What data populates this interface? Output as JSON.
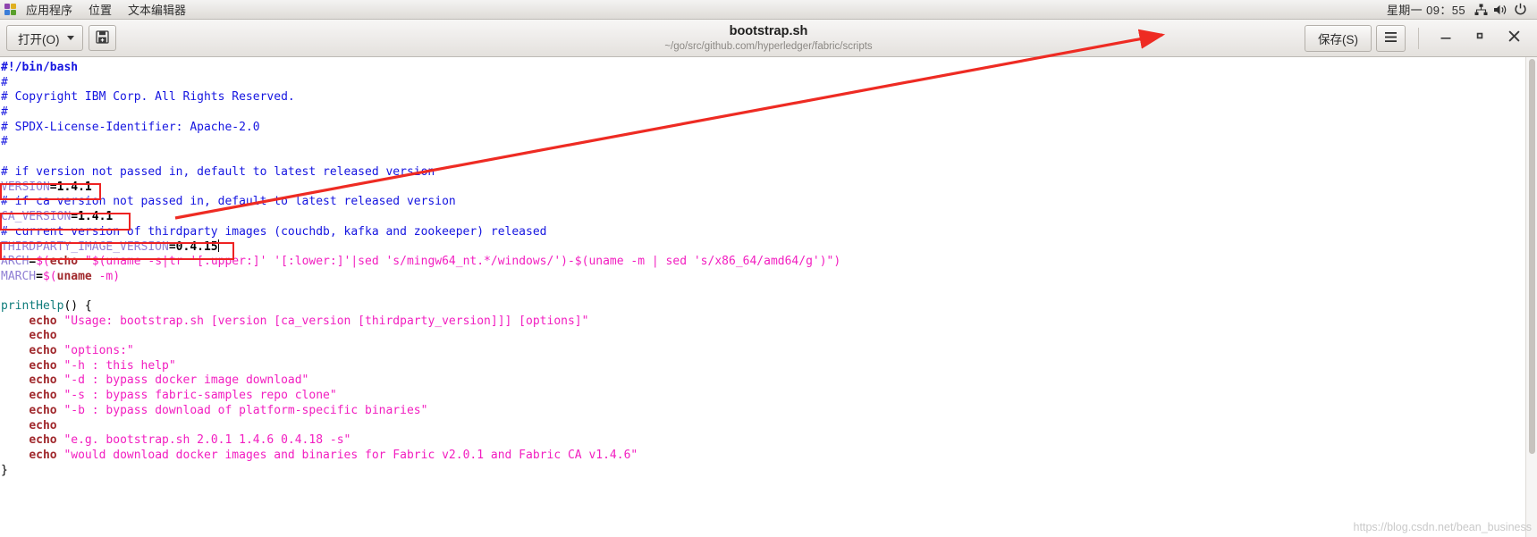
{
  "panel": {
    "apps_icon": "applications-icon",
    "items": [
      {
        "label": "应用程序",
        "name": "panel-menu-applications"
      },
      {
        "label": "位置",
        "name": "panel-menu-places"
      },
      {
        "label": "文本编辑器",
        "name": "panel-menu-text-editor"
      }
    ],
    "clock": "星期一 09：55",
    "tray": [
      {
        "name": "network-icon"
      },
      {
        "name": "volume-icon"
      },
      {
        "name": "power-icon"
      }
    ]
  },
  "headerbar": {
    "open_label": "打开(O)",
    "save_sidebar_icon": "save-document-icon",
    "title": "bootstrap.sh",
    "subtitle": "~/go/src/github.com/hyperledger/fabric/scripts",
    "save_label": "保存(S)",
    "menu_icon": "hamburger-menu-icon",
    "minimize_icon": "minimize-icon",
    "maximize_icon": "maximize-icon",
    "close_icon": "close-icon"
  },
  "editor": {
    "filename": "bootstrap.sh",
    "lines": [
      "#!/bin/bash",
      "#",
      "# Copyright IBM Corp. All Rights Reserved.",
      "#",
      "# SPDX-License-Identifier: Apache-2.0",
      "#",
      "",
      "# if version not passed in, default to latest released version",
      "VERSION=1.4.1",
      "# if ca version not passed in, default to latest released version",
      "CA_VERSION=1.4.1",
      "# current version of thirdparty images (couchdb, kafka and zookeeper) released",
      "THIRDPARTY_IMAGE_VERSION=0.4.15",
      "ARCH=$(echo \"$(uname -s|tr '[:upper:]' '[:lower:]'|sed 's/mingw64_nt.*/windows/')-$(uname -m | sed 's/x86_64/amd64/g')\")",
      "MARCH=$(uname -m)",
      "",
      "printHelp() {",
      "    echo \"Usage: bootstrap.sh [version [ca_version [thirdparty_version]]] [options]\"",
      "    echo",
      "    echo \"options:\"",
      "    echo \"-h : this help\"",
      "    echo \"-d : bypass docker image download\"",
      "    echo \"-s : bypass fabric-samples repo clone\"",
      "    echo \"-b : bypass download of platform-specific binaries\"",
      "    echo",
      "    echo \"e.g. bootstrap.sh 2.0.1 1.4.6 0.4.18 -s\"",
      "    echo \"would download docker images and binaries for Fabric v2.0.1 and Fabric CA v1.4.6\"",
      "}"
    ],
    "variables": [
      {
        "name": "VERSION",
        "value": "1.4.1"
      },
      {
        "name": "CA_VERSION",
        "value": "1.4.1"
      },
      {
        "name": "THIRDPARTY_IMAGE_VERSION",
        "value": "0.4.15"
      }
    ]
  },
  "annotations": {
    "highlight_color": "#ee2222",
    "boxes": [
      {
        "name": "version-highlight-box",
        "target": "VERSION=1.4.1"
      },
      {
        "name": "ca-version-highlight-box",
        "target": "CA_VERSION=1.4.1"
      },
      {
        "name": "thirdparty-version-highlight-box",
        "target": "THIRDPARTY_IMAGE_VERSION=0.4.15"
      }
    ],
    "arrow": {
      "name": "save-button-arrow",
      "points_to": "保存(S)"
    }
  },
  "watermark": "https://blog.csdn.net/bean_business"
}
